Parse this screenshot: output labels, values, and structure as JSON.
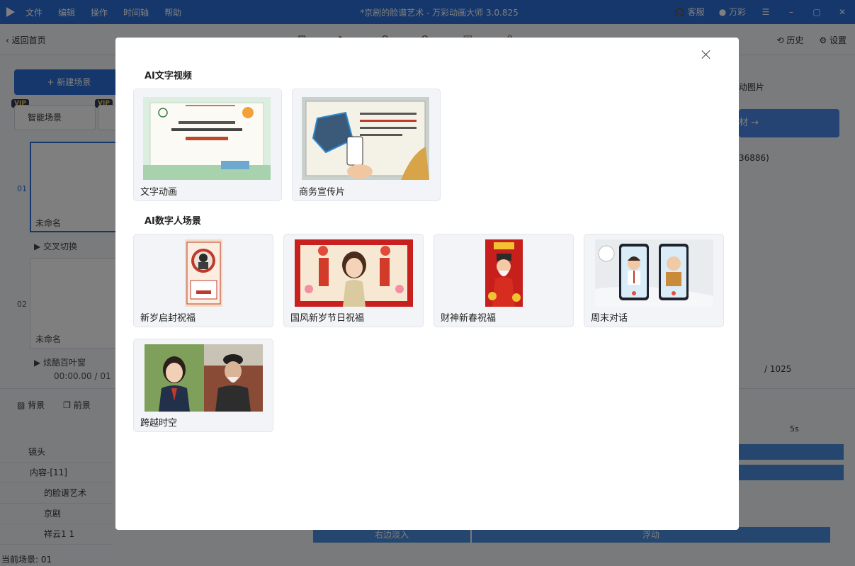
{
  "app": {
    "title": "*京剧的脸谱艺术 - 万彩动画大师 3.0.825",
    "menu": [
      "文件",
      "编辑",
      "操作",
      "时间轴",
      "帮助"
    ],
    "service": "客服",
    "user": "万彩",
    "back": "返回首页",
    "history": "历史",
    "settings": "设置"
  },
  "left": {
    "new_scene": "新建场景",
    "smart_scene": "智能场景",
    "vip": "VIP",
    "scenes": [
      {
        "num": "01",
        "name": "未命名",
        "transition": "交叉切换"
      },
      {
        "num": "02",
        "name": "未命名",
        "transition": "炫酷百叶窗"
      }
    ],
    "time": "00:00.00",
    "time_total": "/ 01"
  },
  "bottom": {
    "tabs": [
      "背景",
      "前景"
    ],
    "layers": [
      "镜头",
      "内容-[11]",
      "的脸谱艺术",
      "京剧",
      "祥云1 1"
    ],
    "status": "当前场景: 01",
    "timeline_labels": [
      "右边淡入",
      "浮动"
    ],
    "time_5s": "5s"
  },
  "right": {
    "add_image": "动图片",
    "material": "材 →",
    "filter_value": "36886)",
    "page_count": "/ 1025"
  },
  "modal": {
    "sections": [
      {
        "title": "AI文字视频",
        "cards": [
          {
            "label": "文字动画"
          },
          {
            "label": "商务宣传片"
          }
        ]
      },
      {
        "title": "AI数字人场景",
        "cards": [
          {
            "label": "新岁启封祝福"
          },
          {
            "label": "国风新岁节日祝福"
          },
          {
            "label": "财神新春祝福"
          },
          {
            "label": "周末对话"
          },
          {
            "label": "跨越时空"
          }
        ]
      }
    ]
  }
}
